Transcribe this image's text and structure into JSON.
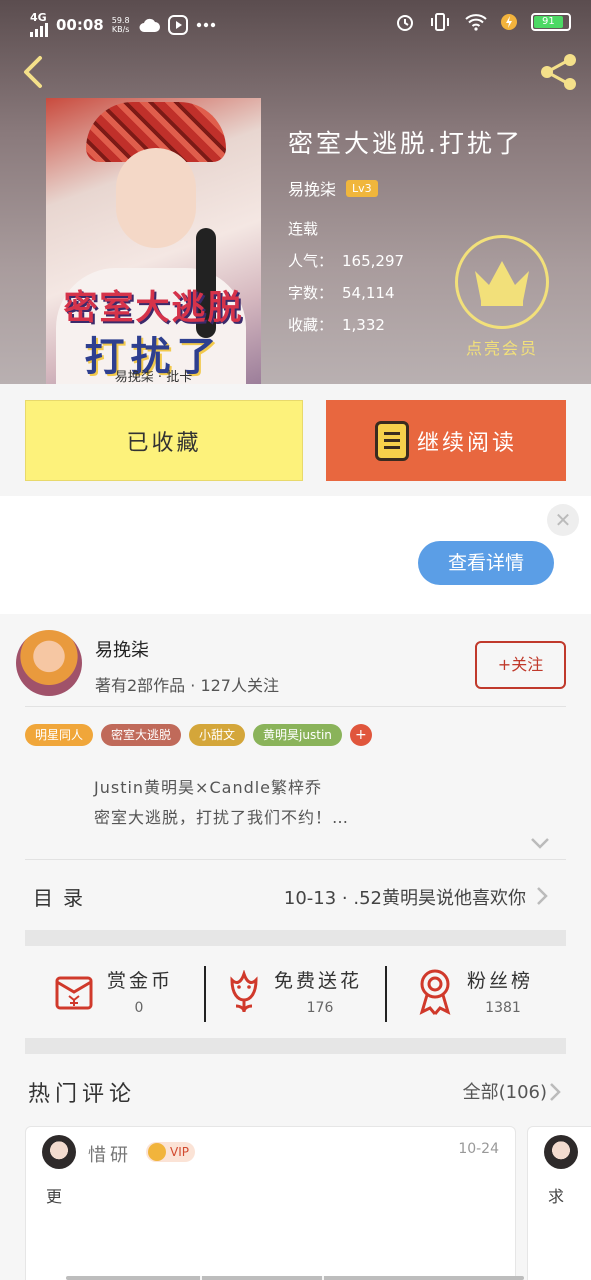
{
  "status_bar": {
    "network": "4G",
    "time": "00:08",
    "speed_value": "59.8",
    "speed_unit": "KB/s",
    "battery": "91"
  },
  "book": {
    "title": "密室大逃脱.打扰了",
    "author": "易挽柒",
    "level": "Lv3",
    "status": "连载",
    "popularity_label": "人气：",
    "popularity": "165,297",
    "words_label": "字数：",
    "words": "54,114",
    "favorites_label": "收藏：",
    "favorites": "1,332",
    "cover_title_line1": "密室大逃脱",
    "cover_title_line2": "打扰了",
    "cover_author": "易挽柒 · 批卡"
  },
  "vip": {
    "label": "点亮会员"
  },
  "actions": {
    "favorited_label": "已收藏",
    "continue_label": "继续阅读"
  },
  "ad": {
    "details_label": "查看详情",
    "close_glyph": "✕"
  },
  "author_card": {
    "name": "易挽柒",
    "meta": "著有2部作品 · 127人关注",
    "follow_label": "+关注"
  },
  "tags": [
    {
      "label": "明星同人",
      "color": "#f0a63a"
    },
    {
      "label": "密室大逃脱",
      "color": "#c06a5a"
    },
    {
      "label": "小甜文",
      "color": "#d4a63a"
    },
    {
      "label": "黄明昊justin",
      "color": "#8ab35a"
    }
  ],
  "tag_more": "+",
  "description": {
    "line1": "Justin黄明昊×Candle繁梓乔",
    "line2": "密室大逃脱，打扰了我们不约！…"
  },
  "toc": {
    "label": "目录",
    "latest": "10-13  ·  .52黄明昊说他喜欢你"
  },
  "stats": [
    {
      "name": "赏金币",
      "value": "0",
      "icon": "red-envelope-icon"
    },
    {
      "name": "免费送花",
      "value": "176",
      "icon": "flower-icon"
    },
    {
      "name": "粉丝榜",
      "value": "1381",
      "icon": "medal-icon"
    }
  ],
  "comments": {
    "heading": "热门评论",
    "all_label": "全部(106)",
    "items": [
      {
        "user": "惜研",
        "vip": "VIP",
        "date": "10-24",
        "text": "更"
      },
      {
        "text": "求"
      }
    ]
  },
  "colors": {
    "accent_orange": "#e8673f",
    "fav_yellow": "#fdf27b",
    "vip_gold": "#f2e07a",
    "follow_red": "#c0392b",
    "details_blue": "#5b9ee6"
  }
}
